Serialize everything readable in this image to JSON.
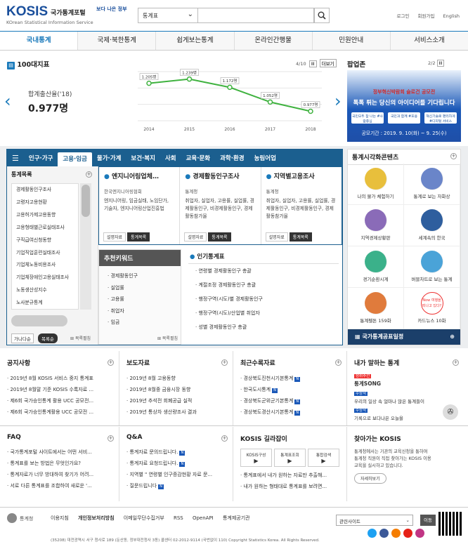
{
  "header": {
    "logo": "KOSIS",
    "logo_kr": "국가통계포털",
    "logo_en": "KOrean Statistical Information Service",
    "slogan": "보다 나은 정부",
    "search_select": "통계표",
    "links": [
      "로그인",
      "회원가입",
      "English"
    ]
  },
  "gnb": [
    "국내통계",
    "국제·북한통계",
    "쉽게보는통계",
    "온라인간행물",
    "민원안내",
    "서비스소개"
  ],
  "indicators": {
    "title": "100대지표",
    "pager": "4/10",
    "more": "더보기",
    "stat_label": "합계출산율('18)",
    "stat_value": "0.977명"
  },
  "chart_data": {
    "type": "line",
    "categories": [
      "2014",
      "2015",
      "2016",
      "2017",
      "2018"
    ],
    "series": [
      {
        "values": [
          1.205,
          1.239,
          1.172,
          1.052,
          0.977
        ]
      }
    ],
    "data_labels": [
      "1.205명",
      "1.239명",
      "1.172명",
      "1.052명",
      "0.977명"
    ],
    "ylim": [
      0.9,
      1.3
    ],
    "color": "#3fb23f"
  },
  "popup": {
    "title": "팝업존",
    "pager": "2/2",
    "line1": "정부혁신박람회 슬로건 공모전",
    "line2": "톡톡 튀는 당신의 아이디어를 기다립니다",
    "chips": [
      "국민모두 참 나는 #사람중심",
      "국민과 함께 #포용",
      "혁신기술로 편리하게 #디지털 서비스"
    ],
    "period": "공모기간 : 2019. 9. 10(화) ~ 9. 25(수)"
  },
  "tabs": [
    "인구·가구",
    "고용·임금",
    "물가·가계",
    "보건·복지",
    "사회",
    "교육·문화",
    "과학·환경",
    "농림어업"
  ],
  "category": {
    "title": "통계목록",
    "items": [
      "경제활동인구조사",
      "고령자고용현황",
      "고용허가제고용동향",
      "고용형태별근로실태조사",
      "구직급여신청동향",
      "기업직업훈련실태조사",
      "기업체노동비용조사",
      "기업체장애인고용실태조사",
      "노동생산성지수",
      "노사분규통계"
    ],
    "tab_a": "가나다순",
    "tab_b": "목록순",
    "more": "목록펼침"
  },
  "cards": [
    {
      "title": "엔지니어링업체…",
      "src": "한국엔지니어링협회",
      "desc": "엔지니어링, 임금실태, 노임단가, 기술자, 엔지니어링산업진흥법",
      "b1": "설명자료",
      "b2": "통계목록"
    },
    {
      "title": "경제활동인구조사",
      "src": "통계청",
      "desc": "취업자, 실업자, 고용률, 실업률, 경제활동인구, 비경제활동인구, 경제활동참가율",
      "b1": "설명자료",
      "b2": "통계목록"
    },
    {
      "title": "지역별고용조사",
      "src": "통계청",
      "desc": "취업자, 실업자, 고용률, 실업률, 경제활동인구, 비경제활동인구, 경제활동참가율",
      "b1": "설명자료",
      "b2": "통계목록"
    }
  ],
  "keywords": {
    "title": "추천키워드",
    "items": [
      "경제활동인구",
      "실업률",
      "고용률",
      "취업자",
      "임금"
    ],
    "more": "목록펼침"
  },
  "popular": {
    "title": "인기통계표",
    "items": [
      "연령별 경제활동인구 총괄",
      "계절조정 경제활동인구 총괄",
      "행정구역(시도)별 경제활동인구",
      "행정구역(시도)/산업별 취업자",
      "성별 경제활동인구 총괄"
    ]
  },
  "visual": {
    "title": "통계시각화콘텐츠",
    "items": [
      "나의 물가 체험하기",
      "통계로 보는 자화상",
      "지역경제상황판",
      "세계속의 한국",
      "경기순환시계",
      "버블차트로 보는 통계",
      "통계펠톤 159화",
      "카드뉴스 10화"
    ],
    "badge": "Now 여행을 떠나고 있다?",
    "footer": "국가통계공표일정"
  },
  "boards": {
    "notice": {
      "title": "공지사항",
      "items": [
        "2019년 8월 KOSIS 서비스 중지 통계표",
        "2019년 8월말 기준 KOSIS 수록자료 ...",
        "제6회 국가승인통계 활용 UCC 공모전...",
        "제6회 국가승인통계활용 UCC 공모전 ..."
      ]
    },
    "press": {
      "title": "보도자료",
      "items": [
        "2019년 8월 고용동향",
        "2019년 8월중 금융시장 동향",
        "2019년 추석전 회폐공급 실적",
        "2019년 통상차 생산량조사 결과"
      ]
    },
    "recent": {
      "title": "최근수록자료",
      "items": [
        "경상북도진천시기본통계",
        "한국도시통계",
        "경상북도군위군기본통계",
        "경상북도경산시기본통계"
      ]
    },
    "myview": {
      "title": "내가 말하는 통계",
      "tag1": "청취추천",
      "song": "통계SONG",
      "tag2": "수상작",
      "q": "우리의 일상 속 얼마나 많은 통계들이",
      "tag3": "수상작",
      "a": "기록으로 보다나은 오늘을"
    },
    "faq": {
      "title": "FAQ",
      "items": [
        "국가통계포털 사이트에서는 어떤 서비...",
        "통계표를 보는 방법은 무엇인가요?",
        "통계자료가 너무 방대하여 찾기가 어려...",
        "서로 다른 통계표를 조합하여 새로운 '..."
      ]
    },
    "qa": {
      "title": "Q&A",
      "items": [
        "통계자료 문의드립니다.",
        "통계자료 요청드립니다.",
        "지역별 \" 연령별 인구증감현황 자료 문...",
        "질문드립니다"
      ]
    },
    "guide": {
      "title": "KOSIS 길라잡이",
      "b1": "KOSIS구성",
      "b2": "통계표조회",
      "b3": "통합검색",
      "items": [
        "통계표에서 내가 원하는 자료만 추출해...",
        "내가 원하는 형태대로 통계표를 보려면..."
      ]
    },
    "visit": {
      "title": "찾아가는 KOSIS",
      "text": "통계청에서는 기관의 교육신청을 통하여 통계청 직원이 직접 찾아가는 KOSIS 이용교육을 실시하고 있습니다.",
      "btn": "자세히보기"
    }
  },
  "footer": {
    "org": "통계청",
    "menu": [
      "이용지침",
      "개인정보처리방침",
      "이메일무단수집거부",
      "RSS",
      "OpenAPI",
      "통계제공기관"
    ],
    "address": "(35208) 대전광역시 서구 청사로 189 (둔산동, 정부대전청사 3동) 콜센터 02-2012-9114 (국번없이 110) Copyright Statistics Korea. All Rights Reserved.",
    "select": "관련사이트",
    "go": "이동"
  },
  "colors": {
    "primary": "#1a7abb",
    "navy": "#1b5f8f",
    "green": "#3fb23f"
  }
}
